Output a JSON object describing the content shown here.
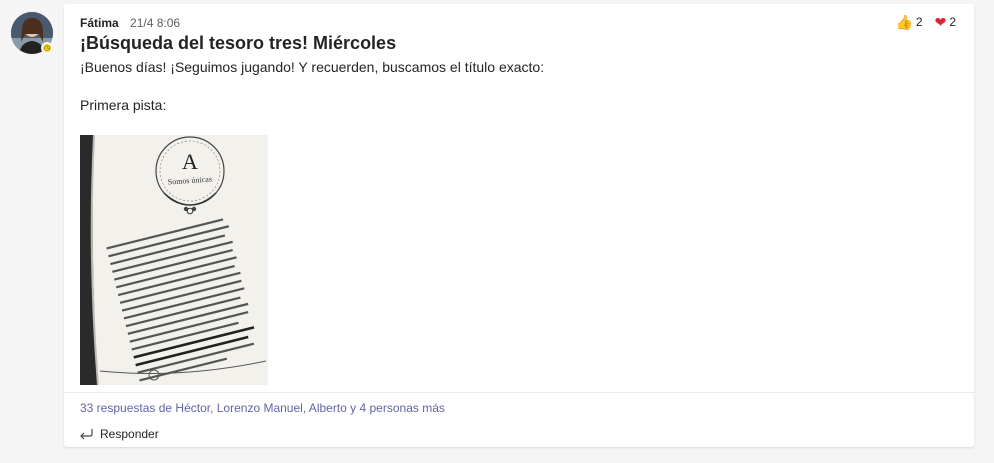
{
  "message": {
    "author": "Fátima",
    "timestamp": "21/4 8:06",
    "title": "¡Búsqueda del tesoro tres! Miércoles",
    "body_line1": "¡Buenos días! ¡Seguimos jugando! Y recuerden, buscamos el título exacto:",
    "body_line2": "Primera pista:",
    "image": {
      "chapter_letter": "A",
      "chapter_title": "Somos únicas"
    }
  },
  "reactions": [
    {
      "icon": "thumbs-up-icon",
      "count": "2"
    },
    {
      "icon": "heart-icon",
      "count": "2"
    }
  ],
  "replies_summary": "33 respuestas de Héctor, Lorenzo Manuel, Alberto y 4 personas más",
  "reply_label": "Responder",
  "colors": {
    "accent": "#6264a7",
    "status": "#f8d22a",
    "heart": "#e0212f",
    "like": "#f2b530"
  }
}
